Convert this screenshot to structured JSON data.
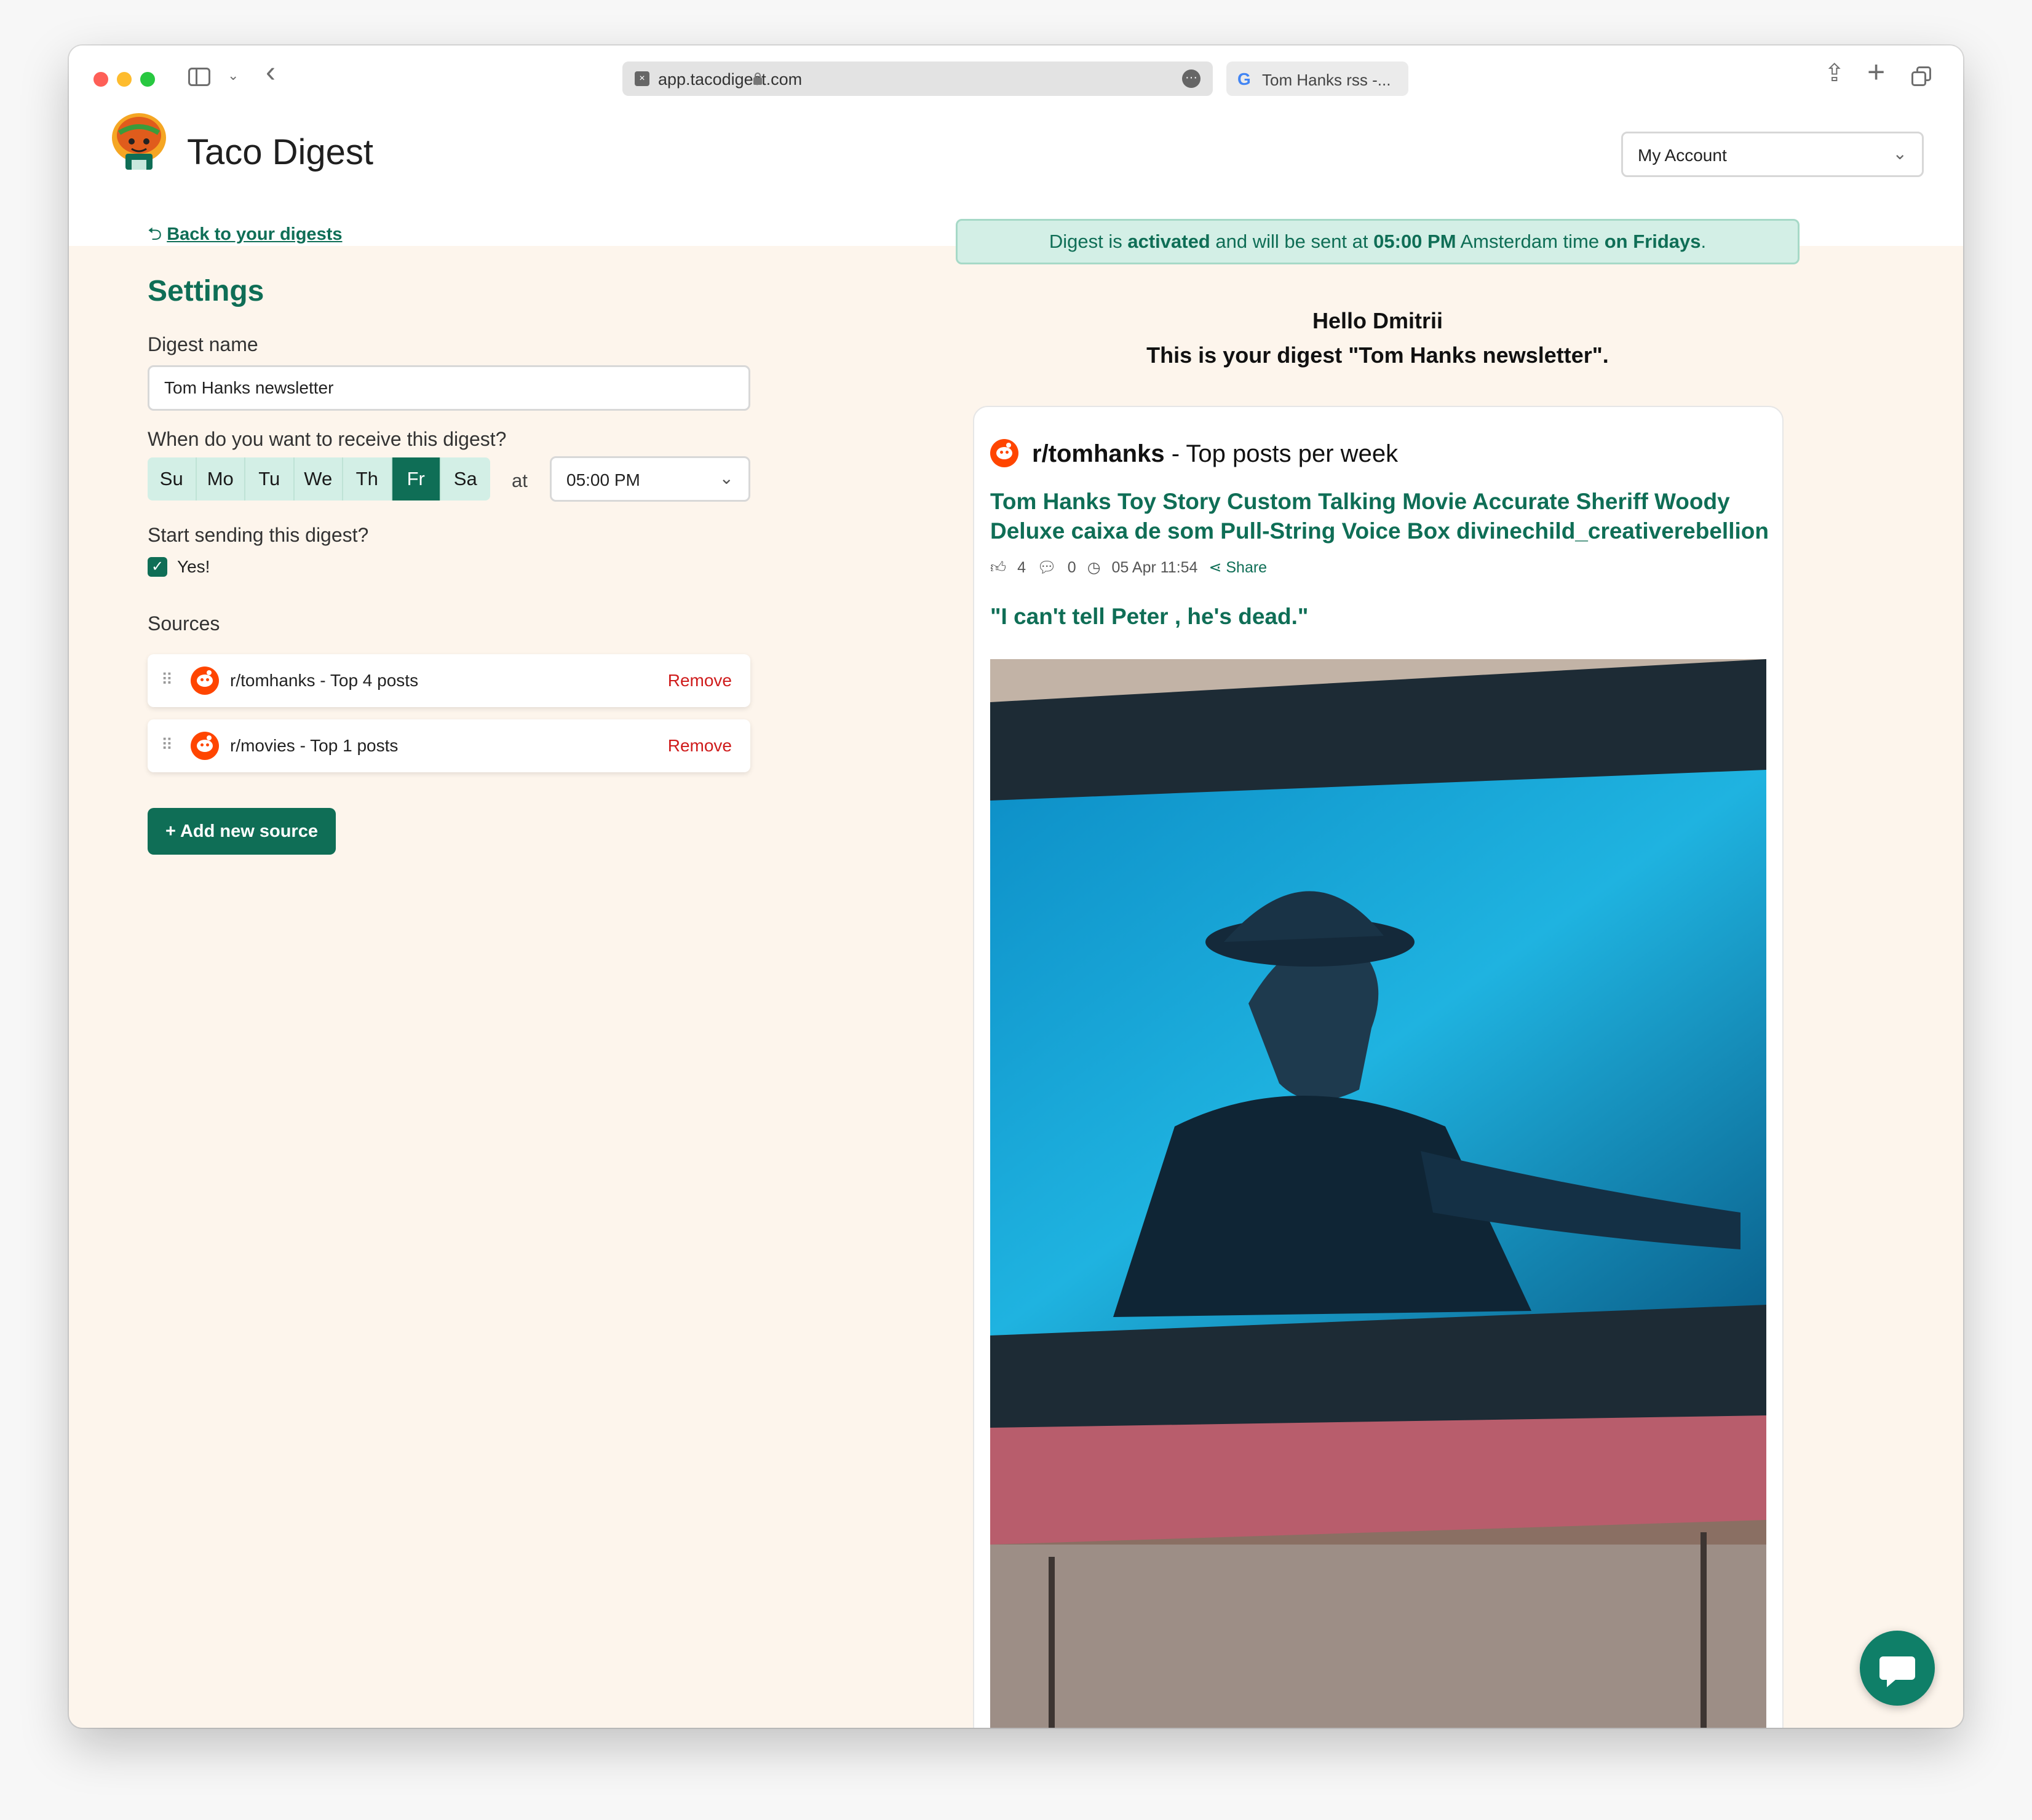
{
  "browser": {
    "url": "app.tacodigest.com",
    "second_tab_title": "Tom Hanks rss -..."
  },
  "app": {
    "title": "Taco Digest",
    "account_menu": "My Account",
    "brand_color": "#0f6e56"
  },
  "settings": {
    "back_link": "Back to your digests",
    "heading": "Settings",
    "digest_name_label": "Digest name",
    "digest_name_value": "Tom Hanks newsletter",
    "schedule_label": "When do you want to receive this digest?",
    "days": [
      {
        "label": "Su",
        "selected": false
      },
      {
        "label": "Mo",
        "selected": false
      },
      {
        "label": "Tu",
        "selected": false
      },
      {
        "label": "We",
        "selected": false
      },
      {
        "label": "Th",
        "selected": false
      },
      {
        "label": "Fr",
        "selected": true
      },
      {
        "label": "Sa",
        "selected": false
      }
    ],
    "at_label": "at",
    "time_value": "05:00 PM",
    "start_label": "Start sending this digest?",
    "start_checked": true,
    "start_checkbox_label": "Yes!",
    "sources_label": "Sources",
    "sources": [
      {
        "name": "r/tomhanks - Top 4 posts",
        "remove_label": "Remove",
        "icon": "reddit-icon"
      },
      {
        "name": "r/movies - Top 1 posts",
        "remove_label": "Remove",
        "icon": "reddit-icon"
      }
    ],
    "add_source_button": "+ Add new source"
  },
  "preview": {
    "banner": {
      "p1": "Digest is ",
      "b1": "activated",
      "p2": " and will be sent at ",
      "b2": "05:00 PM",
      "p3": " Amsterdam time ",
      "b3": "on Fridays",
      "p4": "."
    },
    "greeting": "Hello Dmitrii",
    "intro": "This is your digest \"Tom Hanks newsletter\".",
    "card": {
      "subreddit": "r/tomhanks",
      "subtitle": " - Top posts per week",
      "post_title": "Tom Hanks Toy Story Custom Talking Movie Accurate Sheriff Woody Deluxe caixa de som Pull-String Voice Box divinechild_creativerebellion",
      "upvotes": "4",
      "comments": "0",
      "date": "05 Apr 11:54",
      "share_label": "Share",
      "second_post_title": "\"I can't tell Peter , he's dead.\""
    }
  }
}
